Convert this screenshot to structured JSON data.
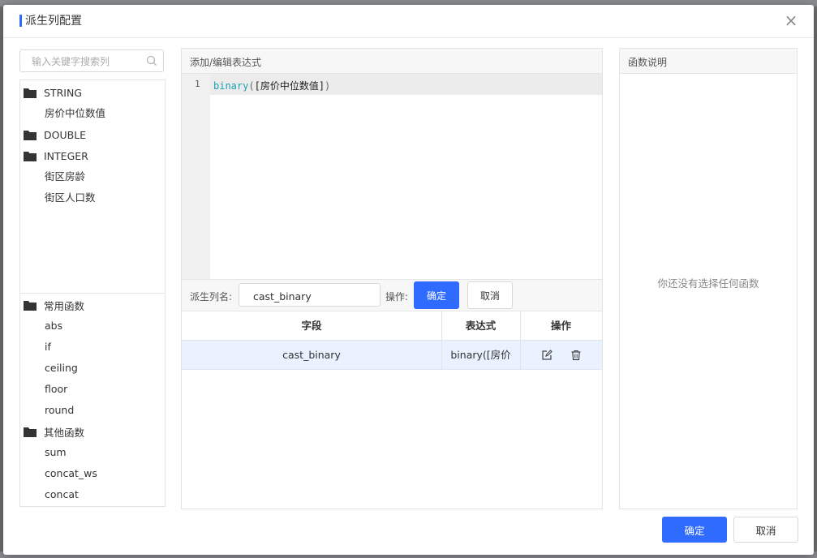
{
  "dialog": {
    "title": "派生列配置",
    "confirm_label": "确定",
    "cancel_label": "取消"
  },
  "left": {
    "search_placeholder": "输入关键字搜索列",
    "columns": {
      "groups": [
        {
          "label": "STRING",
          "items": [
            "房价中位数值"
          ]
        },
        {
          "label": "DOUBLE",
          "items": []
        },
        {
          "label": "INTEGER",
          "items": [
            "街区房龄",
            "街区人口数"
          ]
        }
      ]
    },
    "functions": {
      "groups": [
        {
          "label": "常用函数",
          "items": [
            "abs",
            "if",
            "ceiling",
            "floor",
            "round"
          ]
        },
        {
          "label": "其他函数",
          "items": [
            "sum",
            "concat_ws",
            "concat"
          ]
        }
      ]
    }
  },
  "editor": {
    "header": "添加/编辑表达式",
    "line_number": "1",
    "code": {
      "fn": "binary",
      "open": "(",
      "arg": "[房价中位数值]",
      "close": ")"
    },
    "name_label": "派生列名:",
    "name_value": "cast_binary",
    "op_label": "操作:",
    "confirm_label": "确定",
    "cancel_label": "取消"
  },
  "table": {
    "headers": [
      "字段",
      "表达式",
      "操作"
    ],
    "rows": [
      {
        "field": "cast_binary",
        "expression": "binary([房价"
      }
    ]
  },
  "help": {
    "header": "函数说明",
    "empty_text": "你还没有选择任何函数"
  },
  "colors": {
    "accent": "#2f6bff",
    "row_selected": "#eaf1ff",
    "code_function": "#1aa3b0"
  },
  "icons": [
    "search-icon",
    "folder-icon",
    "close-icon",
    "edit-icon",
    "trash-icon"
  ]
}
